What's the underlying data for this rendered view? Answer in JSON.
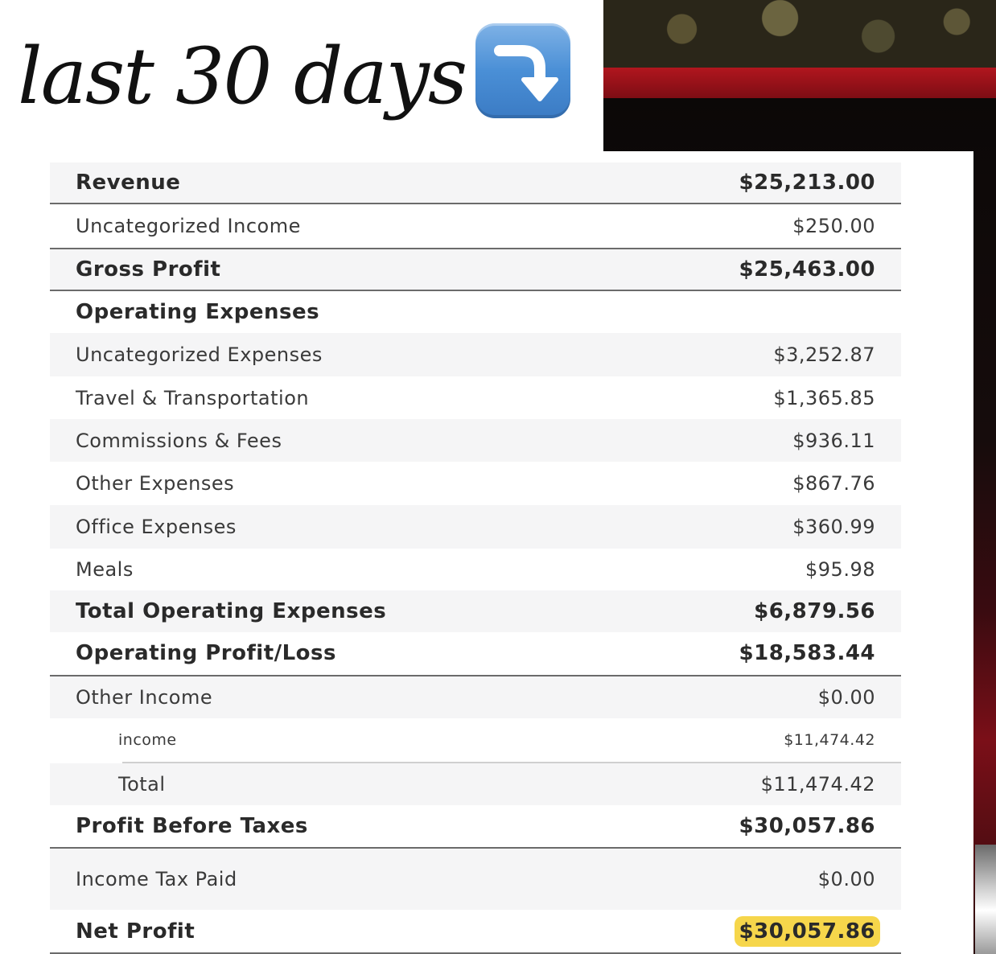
{
  "title": "last 30 days",
  "title_icon": "right-arrow-curving-down-icon",
  "colors": {
    "highlight": "#f6d64b",
    "emoji_blue": "#4a8fd6",
    "photo_red": "#b1161e"
  },
  "report": {
    "revenue": {
      "label": "Revenue",
      "amount": "$25,213.00"
    },
    "uncategorized_income": {
      "label": "Uncategorized Income",
      "amount": "$250.00"
    },
    "gross_profit": {
      "label": "Gross Profit",
      "amount": "$25,463.00"
    },
    "operating_expenses_header": {
      "label": "Operating Expenses"
    },
    "expenses": [
      {
        "label": "Uncategorized Expenses",
        "amount": "$3,252.87"
      },
      {
        "label": "Travel & Transportation",
        "amount": "$1,365.85"
      },
      {
        "label": "Commissions & Fees",
        "amount": "$936.11"
      },
      {
        "label": "Other Expenses",
        "amount": "$867.76"
      },
      {
        "label": "Office Expenses",
        "amount": "$360.99"
      },
      {
        "label": "Meals",
        "amount": "$95.98"
      }
    ],
    "total_operating_expenses": {
      "label": "Total Operating Expenses",
      "amount": "$6,879.56"
    },
    "operating_profit_loss": {
      "label": "Operating Profit/Loss",
      "amount": "$18,583.44"
    },
    "other_income": {
      "label": "Other Income",
      "amount": "$0.00"
    },
    "other_income_income": {
      "label": "income",
      "amount": "$11,474.42"
    },
    "other_income_total": {
      "label": "Total",
      "amount": "$11,474.42"
    },
    "profit_before_taxes": {
      "label": "Profit Before Taxes",
      "amount": "$30,057.86"
    },
    "income_tax_paid": {
      "label": "Income Tax Paid",
      "amount": "$0.00"
    },
    "net_profit": {
      "label": "Net Profit",
      "amount": "$30,057.86"
    }
  }
}
